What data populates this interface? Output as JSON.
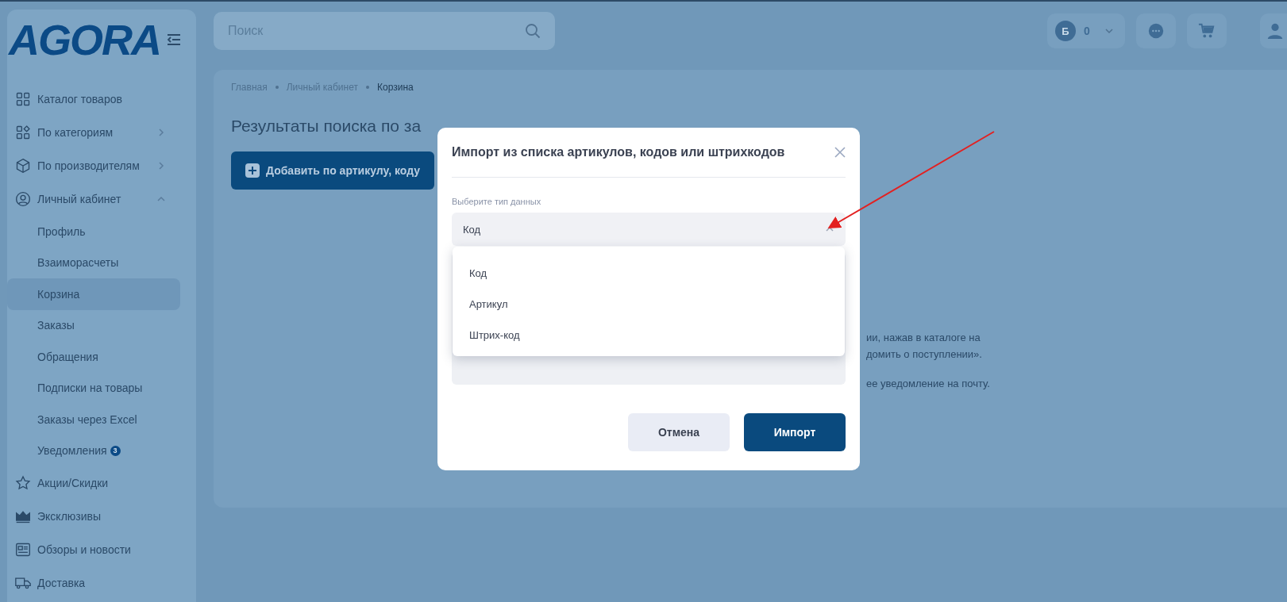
{
  "logo": {
    "text": "AGORA"
  },
  "search": {
    "placeholder": "Поиск"
  },
  "header": {
    "balance_letter": "Б",
    "balance": "0"
  },
  "sidebar": {
    "items": [
      {
        "label": "Каталог товаров",
        "selected": false
      },
      {
        "label": "По категориям",
        "selected": false,
        "expanded": false
      },
      {
        "label": "По производителям",
        "selected": false,
        "expanded": false
      },
      {
        "label": "Личный кабинет",
        "selected": false,
        "expanded": true,
        "children": [
          {
            "label": "Профиль",
            "selected": false
          },
          {
            "label": "Взаиморасчеты",
            "selected": false
          },
          {
            "label": "Корзина",
            "selected": true
          },
          {
            "label": "Заказы",
            "selected": false
          },
          {
            "label": "Обращения",
            "selected": false
          },
          {
            "label": "Подписки на товары",
            "selected": false
          },
          {
            "label": "Заказы через Excel",
            "selected": false
          },
          {
            "label": "Уведомления",
            "selected": false,
            "badge": "3"
          }
        ]
      },
      {
        "label": "Акции/Скидки",
        "selected": false
      },
      {
        "label": "Эксклюзивы",
        "selected": false
      },
      {
        "label": "Обзоры и новости",
        "selected": false
      },
      {
        "label": "Доставка",
        "selected": false
      }
    ]
  },
  "breadcrumbs": [
    "Главная",
    "Личный кабинет",
    "Корзина"
  ],
  "content": {
    "heading": "Результаты поиска по за",
    "add_button": "Добавить по артикулу, коду",
    "fragments": [
      "ии, нажав в каталоге на",
      "домить о поступлении».",
      "ее уведомление на почту."
    ]
  },
  "modal": {
    "title": "Импорт из списка артикулов, кодов или штрихкодов",
    "field_label": "Выберите тип данных",
    "select_value": "Код",
    "expanded": true,
    "options": [
      "Код",
      "Артикул",
      "Штрих-код"
    ],
    "buttons": [
      {
        "label": "Отмена",
        "kind": "secondary"
      },
      {
        "label": "Импорт",
        "kind": "primary"
      }
    ]
  }
}
